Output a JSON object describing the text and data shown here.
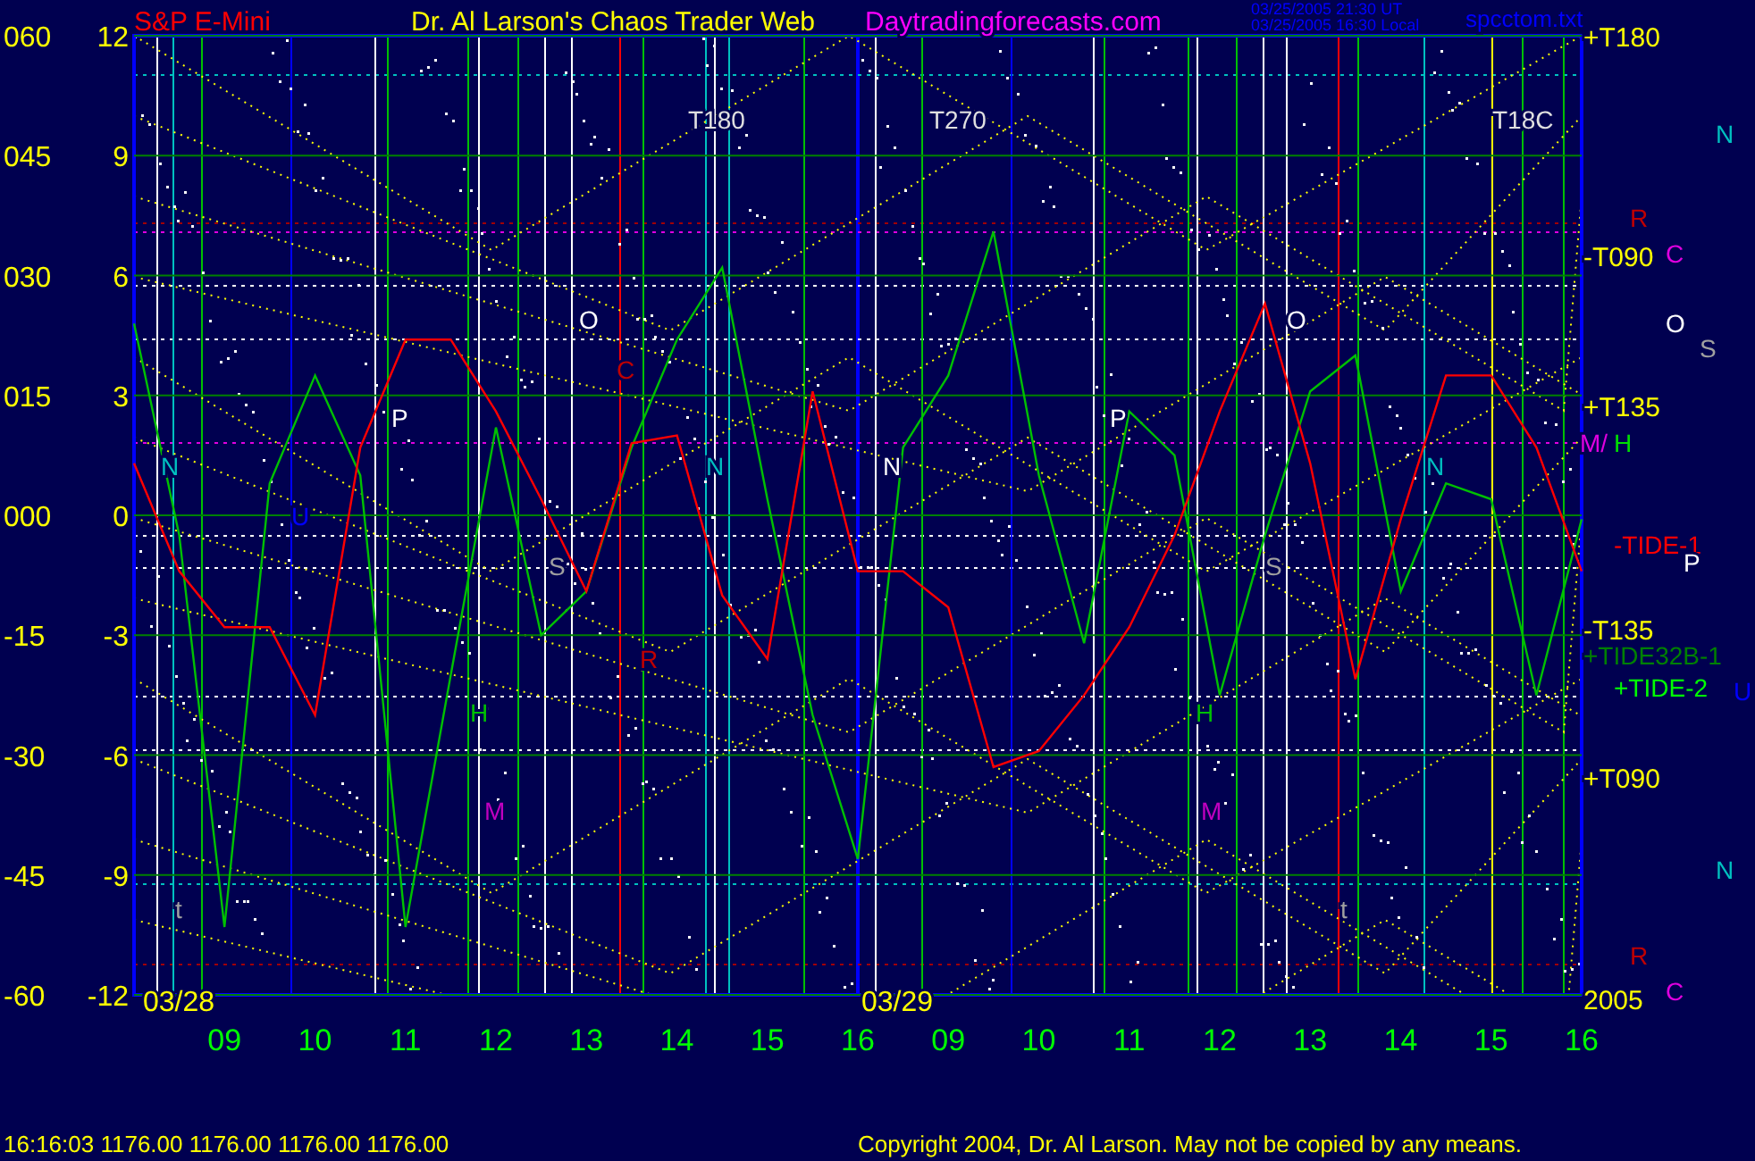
{
  "header": {
    "instrument": "S&P E-Mini",
    "title": "Dr. Al Larson's Chaos Trader Web",
    "site": "Daytradingforecasts.com",
    "timestamp_ut": "03/25/2005 21:30 UT",
    "timestamp_local": "03/25/2005 16:30 Local",
    "file": "spcctom.txt"
  },
  "y_axis_outer": [
    "060",
    "045",
    "030",
    "015",
    "000",
    "-15",
    "-30",
    "-45",
    "-60"
  ],
  "dates": [
    "03/28",
    "03/29"
  ],
  "chart_data": {
    "type": "line",
    "ylim": [
      -12,
      12
    ],
    "grid": true,
    "yticks": [
      {
        "value": 12,
        "label": "12"
      },
      {
        "value": 9,
        "label": "9"
      },
      {
        "value": 6,
        "label": "6"
      },
      {
        "value": 3,
        "label": "3"
      },
      {
        "value": 0,
        "label": "0"
      },
      {
        "value": -3,
        "label": "-3"
      },
      {
        "value": -6,
        "label": "-6"
      },
      {
        "value": -9,
        "label": "-9"
      },
      {
        "value": -12,
        "label": "-12"
      }
    ],
    "categories": [
      null,
      null,
      "09",
      null,
      "10",
      null,
      "11",
      null,
      "12",
      null,
      "13",
      null,
      "14",
      null,
      "15",
      null,
      "16",
      null,
      "09",
      null,
      "10",
      null,
      "11",
      null,
      "12",
      null,
      "13",
      null,
      "14",
      null,
      "15",
      null,
      "16"
    ],
    "series": [
      {
        "color": "#00c000",
        "values": [
          4.8,
          -0.5,
          -10.3,
          0.8,
          3.5,
          1,
          -10.3,
          -4,
          2.2,
          -3,
          -1.9,
          1.7,
          4.4,
          6.2,
          0.4,
          -5,
          -8.6,
          1.7,
          3.5,
          7.1,
          1,
          -3.2,
          2.6,
          1.5,
          -4.5,
          -0.5,
          3.1,
          4,
          -1.9,
          0.8,
          0.4,
          -4.5,
          -0.1
        ]
      },
      {
        "color": "#ff0000",
        "values": [
          1.3,
          -1.4,
          -2.8,
          -2.8,
          -5,
          1.7,
          4.4,
          4.4,
          2.6,
          0.4,
          -1.9,
          1.8,
          2,
          -2,
          -3.6,
          3.1,
          -1.4,
          -1.4,
          -2.3,
          -6.3,
          -5.9,
          -4.5,
          -2.8,
          -0.5,
          2.6,
          5.3,
          1.3,
          -4.1,
          -0.1,
          3.5,
          3.5,
          1.7,
          -1.4
        ]
      }
    ]
  },
  "right_scale": [
    "+T180",
    "-T090",
    "+T135",
    "-T135",
    "+T090",
    "2005"
  ],
  "right_labels": [
    {
      "text": "N",
      "color": "#00c0c0"
    },
    {
      "text": "R",
      "color": "#c00000"
    },
    {
      "text": "C",
      "color": "#e000e0"
    },
    {
      "text": "O",
      "color": "#ffffff"
    },
    {
      "text": "S",
      "color": "#a0a0a0"
    },
    {
      "text": "M/",
      "color": "#e000e0"
    },
    {
      "text": "H",
      "color": "#00e000"
    },
    {
      "text": "-TIDE-1",
      "color": "#ff0000"
    },
    {
      "text": "P",
      "color": "#ffffff"
    },
    {
      "text": "+TIDE32B-1",
      "color": "#008000"
    },
    {
      "text": "+TIDE-2",
      "color": "#00ff00"
    },
    {
      "text": "U",
      "color": "#0000ff"
    },
    {
      "text": "N",
      "color": "#00c0c0"
    },
    {
      "text": "R",
      "color": "#c00000"
    },
    {
      "text": "C",
      "color": "#e000e0"
    }
  ],
  "plot_labels": [
    {
      "text": "T180",
      "color": "#e0e0e0"
    },
    {
      "text": "T270",
      "color": "#e0e0e0"
    },
    {
      "text": "T18C",
      "color": "#e0e0e0"
    },
    {
      "text": "O",
      "color": "#ffffff"
    },
    {
      "text": "O",
      "color": "#ffffff"
    },
    {
      "text": "P",
      "color": "#ffffff"
    },
    {
      "text": "P",
      "color": "#ffffff"
    },
    {
      "text": "N",
      "color": "#00c0c0"
    },
    {
      "text": "N",
      "color": "#00c0c0"
    },
    {
      "text": "N",
      "color": "#ffffff"
    },
    {
      "text": "N",
      "color": "#00c0c0"
    },
    {
      "text": "S",
      "color": "#a0a0a0"
    },
    {
      "text": "S",
      "color": "#a0a0a0"
    },
    {
      "text": "H",
      "color": "#00c000"
    },
    {
      "text": "H",
      "color": "#00c000"
    },
    {
      "text": "M",
      "color": "#c000c0"
    },
    {
      "text": "M",
      "color": "#c000c0"
    },
    {
      "text": "C",
      "color": "#c00000"
    },
    {
      "text": "R",
      "color": "#c00000"
    },
    {
      "text": "U",
      "color": "#0000ff"
    },
    {
      "text": "t",
      "color": "#a0a0a0"
    },
    {
      "text": "t",
      "color": "#a0a0a0"
    }
  ],
  "status_bar": {
    "time": "16:16:03",
    "prices": [
      "1176.00",
      "1176.00",
      "1176.00",
      "1176.00"
    ]
  },
  "copyright": "Copyright 2004, Dr. Al Larson. May not be copied by any means."
}
